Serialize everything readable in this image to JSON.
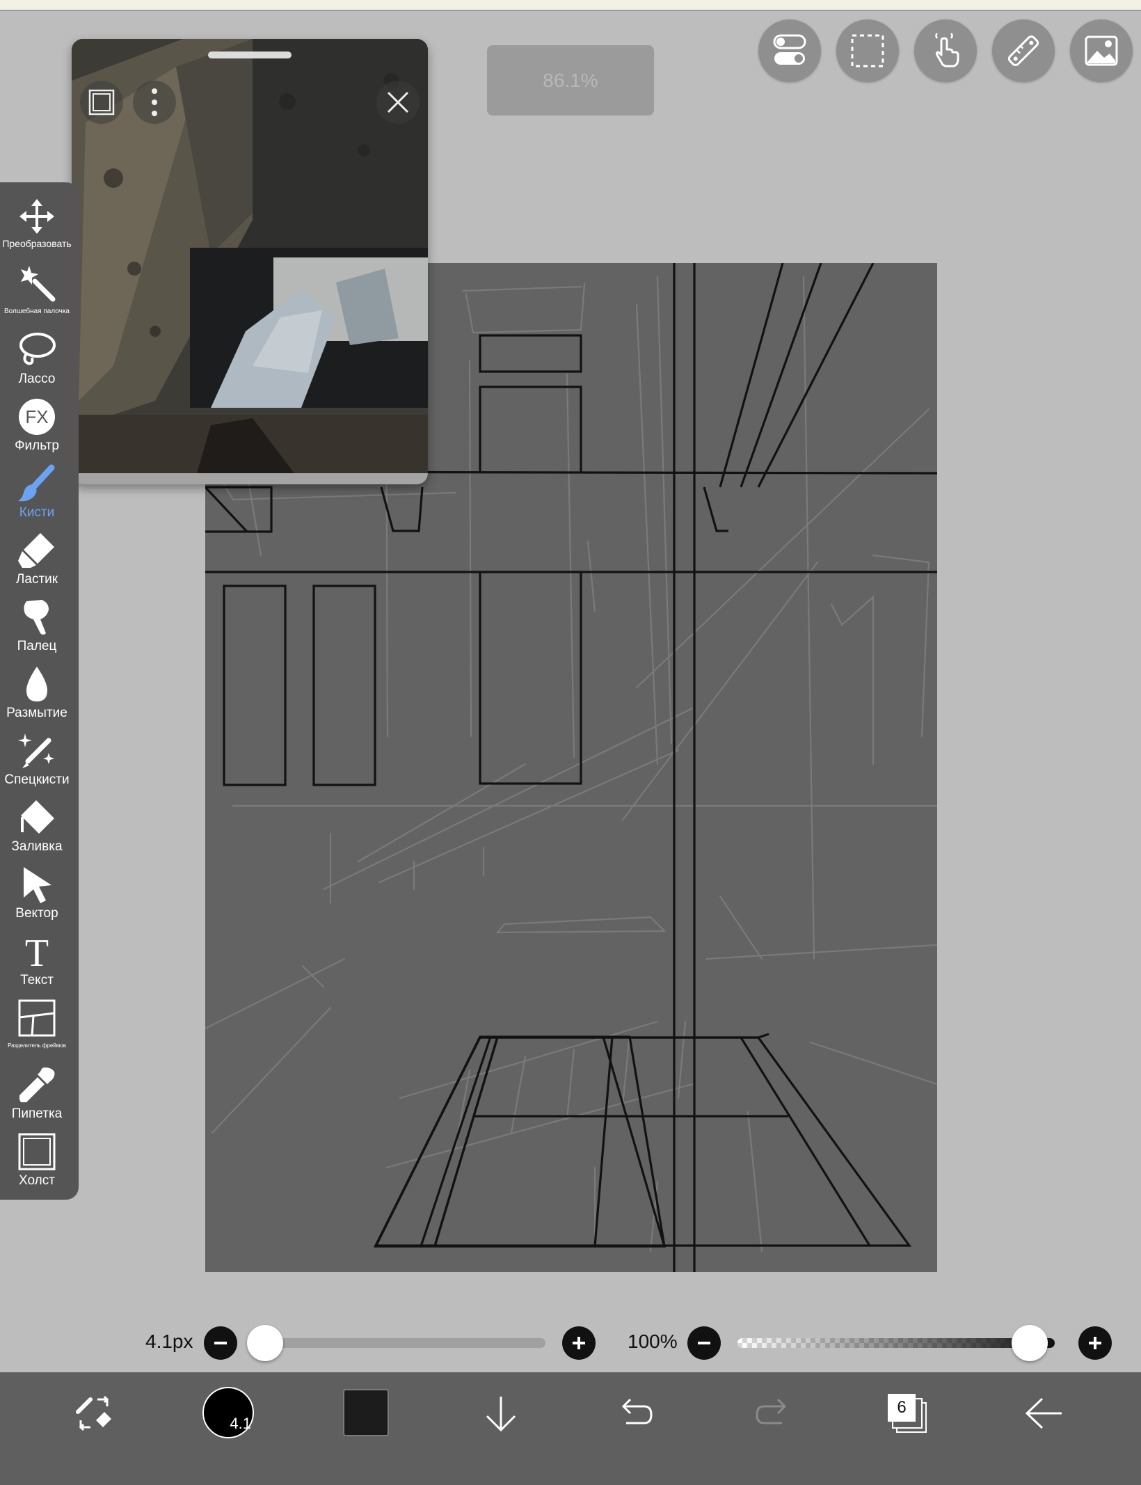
{
  "zoom": {
    "value": "86.1%"
  },
  "reference_window": {
    "image_name": "reference-photo-stairwell"
  },
  "tools": [
    {
      "label": "Преобразовать",
      "icon": "move-arrows-icon"
    },
    {
      "label": "Волшебная палочка",
      "icon": "magic-wand-icon"
    },
    {
      "label": "Лассо",
      "icon": "lasso-icon"
    },
    {
      "label": "Фильтр",
      "icon": "fx-icon"
    },
    {
      "label": "Кисти",
      "icon": "brush-icon",
      "active": true
    },
    {
      "label": "Ластик",
      "icon": "eraser-icon"
    },
    {
      "label": "Палец",
      "icon": "finger-smudge-icon"
    },
    {
      "label": "Размытие",
      "icon": "blur-drop-icon"
    },
    {
      "label": "Спецкисти",
      "icon": "special-brush-icon"
    },
    {
      "label": "Заливка",
      "icon": "fill-bucket-icon"
    },
    {
      "label": "Вектор",
      "icon": "vector-arrow-icon"
    },
    {
      "label": "Текст",
      "icon": "text-icon"
    },
    {
      "label": "Разделитель фреймов",
      "icon": "frame-divider-icon"
    },
    {
      "label": "Пипетка",
      "icon": "eyedropper-icon"
    },
    {
      "label": "Холст",
      "icon": "canvas-icon"
    }
  ],
  "brush_size": {
    "label": "4.1px",
    "fraction": 0.04
  },
  "opacity": {
    "label": "100%",
    "fraction": 1.0
  },
  "bottom_bar": {
    "brush_preview_label": "4.1",
    "layers_count": "6",
    "primary_color": "#1c1c1c"
  },
  "colors": {
    "accent": "#6ca2f2",
    "canvas": "#636363",
    "toolbar": "#555555"
  }
}
